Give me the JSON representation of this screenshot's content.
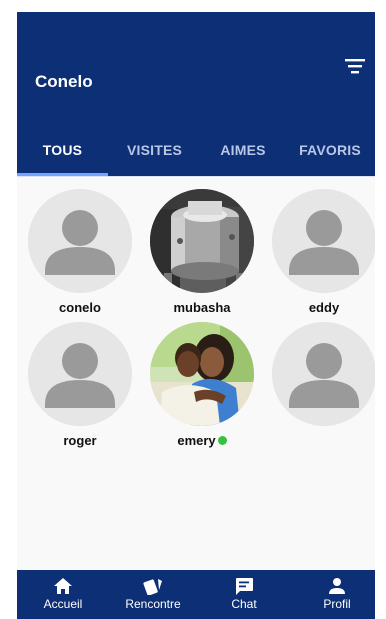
{
  "header": {
    "title": "Conelo"
  },
  "icons": {
    "filter": "filter-icon"
  },
  "tabs": [
    {
      "label": "TOUS"
    },
    {
      "label": "VISITES"
    },
    {
      "label": "AIMES"
    },
    {
      "label": "FAVORIS"
    }
  ],
  "users": [
    {
      "name": "conelo",
      "avatar": "placeholder"
    },
    {
      "name": "mubasha",
      "avatar": "photo-cooking-pot"
    },
    {
      "name": "eddy",
      "avatar": "placeholder"
    },
    {
      "name": "roger",
      "avatar": "placeholder"
    },
    {
      "name": "emery",
      "avatar": "photo-couple",
      "online": true
    },
    {
      "name": "",
      "avatar": "placeholder"
    }
  ],
  "bottom_nav": [
    {
      "label": "Accueil",
      "icon": "home-icon"
    },
    {
      "label": "Rencontre",
      "icon": "cards-icon"
    },
    {
      "label": "Chat",
      "icon": "chat-icon"
    },
    {
      "label": "Profil",
      "icon": "person-icon"
    }
  ],
  "colors": {
    "primary": "#0d2f76",
    "online": "#34c241",
    "tab_indicator": "#6fa5ff"
  }
}
